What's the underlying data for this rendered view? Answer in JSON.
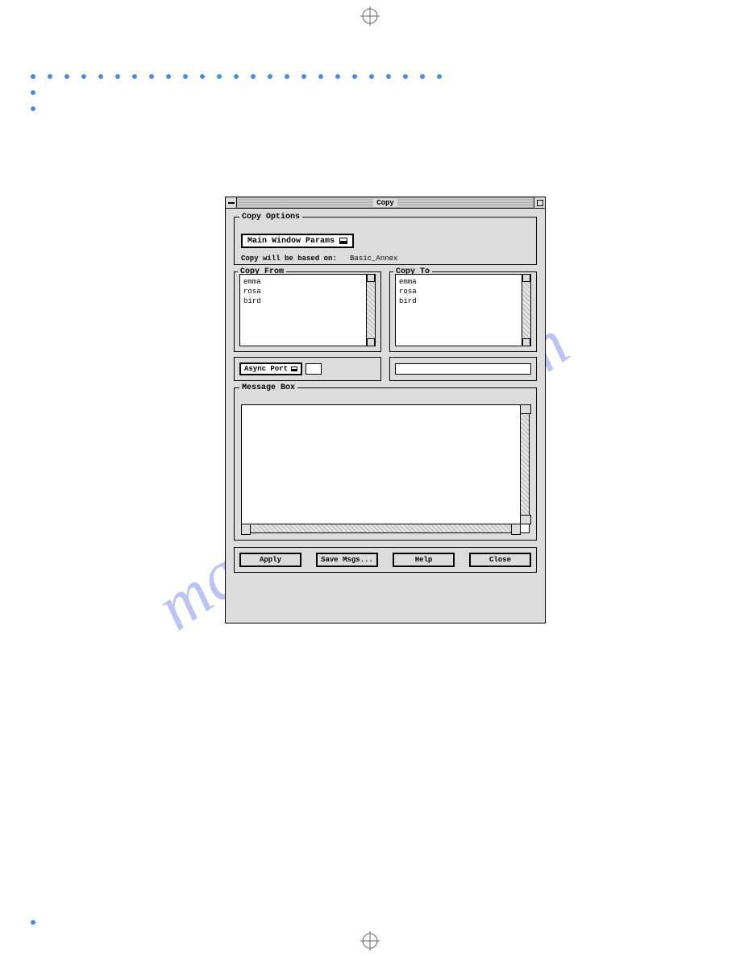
{
  "watermark": "manualshive.com",
  "window": {
    "title": "Copy"
  },
  "copy_options": {
    "legend": "Copy Options",
    "option_menu": "Main Window Params",
    "based_on_label": "Copy will be based on:",
    "based_on_value": "Basic_Annex"
  },
  "copy_from": {
    "legend": "Copy From",
    "items": [
      "emma",
      "rosa",
      "bird"
    ]
  },
  "copy_to": {
    "legend": "Copy To",
    "items": [
      "emma",
      "rosa",
      "bird"
    ]
  },
  "port_menu": "Async Port",
  "message_box": {
    "legend": "Message Box"
  },
  "buttons": {
    "apply": "Apply",
    "save": "Save Msgs...",
    "help": "Help",
    "close": "Close"
  }
}
